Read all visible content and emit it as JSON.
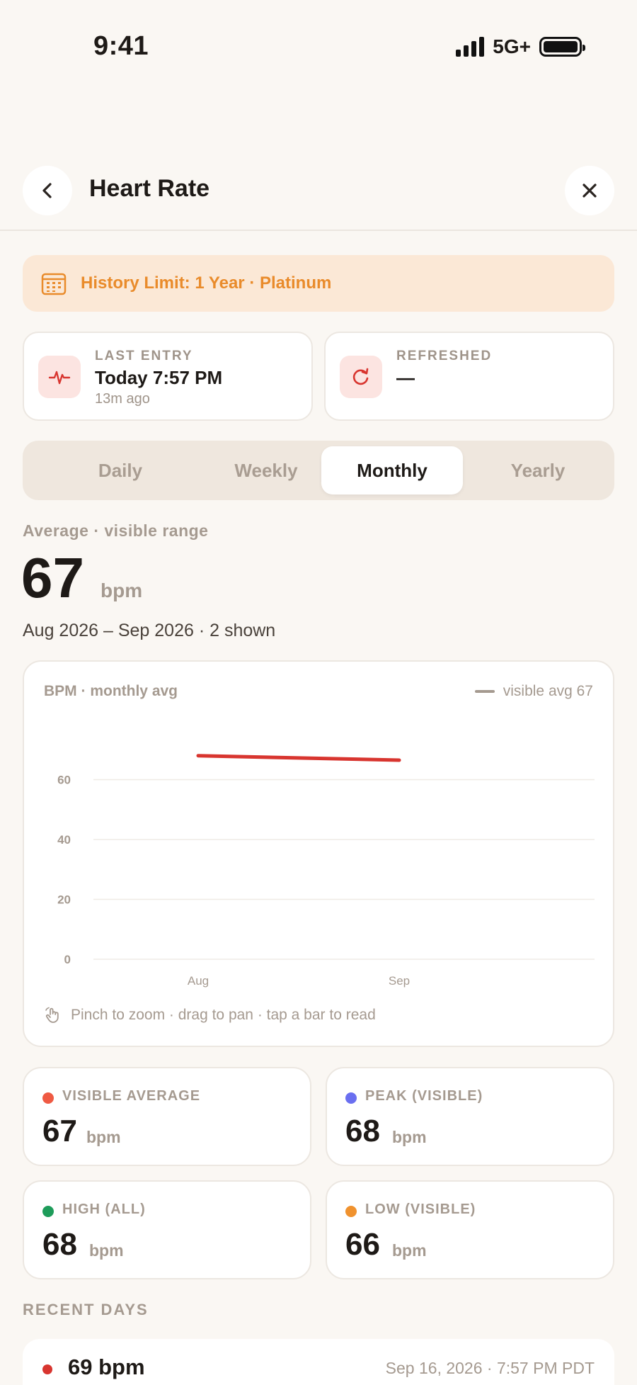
{
  "status_bar": {
    "time": "9:41",
    "network": "5G+"
  },
  "nav": {
    "title": "Heart Rate"
  },
  "banner": {
    "text": "History Limit: 1 Year · Platinum"
  },
  "last_entry": {
    "label": "LAST ENTRY",
    "value": "Today 7:57 PM",
    "sub": "13m ago"
  },
  "refreshed": {
    "label": "REFRESHED",
    "value": "—"
  },
  "tabs": [
    {
      "label": "Daily"
    },
    {
      "label": "Weekly"
    },
    {
      "label": "Monthly",
      "active": true
    },
    {
      "label": "Yearly"
    }
  ],
  "summary": {
    "label": "Average · visible range",
    "value": "67",
    "unit": "bpm",
    "range": "Aug 2026 – Sep 2026 · 2 shown"
  },
  "chart": {
    "title": "BPM · monthly avg",
    "legend": "visible avg 67",
    "hint": "Pinch to zoom · drag to pan · tap a bar to read"
  },
  "chart_data": {
    "type": "line",
    "categories": [
      "Aug",
      "Sep"
    ],
    "series": [
      {
        "values": [
          68,
          66.5
        ]
      }
    ],
    "ylim": [
      0,
      80
    ],
    "yticks": [
      0,
      20,
      40,
      60
    ],
    "grid": true,
    "legend": [
      "visible avg 67"
    ],
    "title": "BPM · monthly avg",
    "series_color": "#d8352f"
  },
  "stats": [
    {
      "label": "VISIBLE AVERAGE",
      "value": "67",
      "unit": "bpm",
      "color": "#ef5a43"
    },
    {
      "label": "PEAK (VISIBLE)",
      "value": "68",
      "unit": "bpm",
      "color": "#6a6ff0"
    },
    {
      "label": "HIGH (ALL)",
      "value": "68",
      "unit": "bpm",
      "color": "#1e9c5a"
    },
    {
      "label": "LOW (VISIBLE)",
      "value": "66",
      "unit": "bpm",
      "color": "#f0922e"
    }
  ],
  "recent": {
    "title": "RECENT DAYS",
    "rows": [
      {
        "bpm": "69 bpm",
        "time": "Sep 16, 2026 · 7:57 PM PDT"
      }
    ]
  },
  "colors": {
    "accent": "#d8352f",
    "banner_text": "#e98b2b",
    "background": "#faf7f3"
  }
}
